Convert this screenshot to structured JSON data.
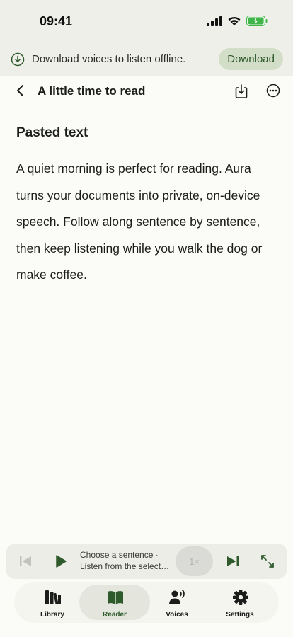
{
  "status_bar": {
    "time": "09:41"
  },
  "banner": {
    "message": "Download voices to listen offline.",
    "button_label": "Download"
  },
  "header": {
    "title": "A little time to read"
  },
  "content": {
    "section_title": "Pasted text",
    "body": "A quiet morning is perfect for reading. Aura turns your documents into private, on-device speech. Follow along sentence by sentence, then keep listening while you walk the dog or make coffee."
  },
  "player": {
    "line1": "Choose a sentence ·",
    "line2": "Listen from the selected sentence",
    "speed": "1×"
  },
  "tabs": [
    {
      "label": "Library",
      "icon": "library-icon"
    },
    {
      "label": "Reader",
      "icon": "reader-icon"
    },
    {
      "label": "Voices",
      "icon": "voices-icon"
    },
    {
      "label": "Settings",
      "icon": "settings-icon"
    }
  ],
  "colors": {
    "accent": "#2e5a2c",
    "banner_button_bg": "#d3dec8",
    "background": "#fbfcf8",
    "battery": "#3fb54a"
  }
}
